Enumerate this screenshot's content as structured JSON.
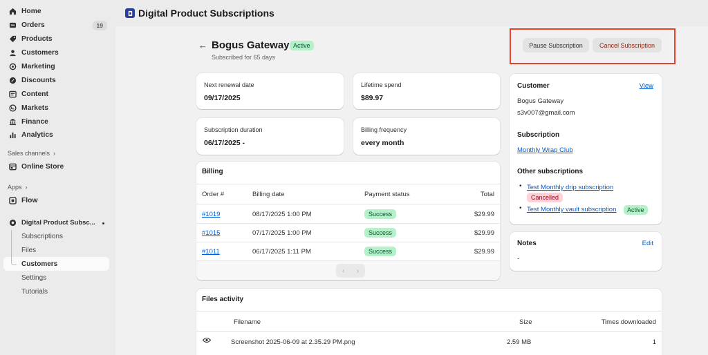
{
  "sidebar": {
    "items": [
      {
        "label": "Home",
        "icon": "home-icon"
      },
      {
        "label": "Orders",
        "icon": "orders-icon",
        "badge": "19"
      },
      {
        "label": "Products",
        "icon": "tag-icon"
      },
      {
        "label": "Customers",
        "icon": "person-icon"
      },
      {
        "label": "Marketing",
        "icon": "target-icon"
      },
      {
        "label": "Discounts",
        "icon": "discount-icon"
      },
      {
        "label": "Content",
        "icon": "content-icon"
      },
      {
        "label": "Markets",
        "icon": "globe-icon"
      },
      {
        "label": "Finance",
        "icon": "bank-icon"
      },
      {
        "label": "Analytics",
        "icon": "bar-chart-icon"
      }
    ],
    "sales_channels_label": "Sales channels",
    "online_store_label": "Online Store",
    "apps_label": "Apps",
    "flow_label": "Flow",
    "app_label": "Digital Product Subsc...",
    "app_subitems": [
      "Subscriptions",
      "Files",
      "Customers",
      "Settings",
      "Tutorials"
    ]
  },
  "header": {
    "title": "Digital Product Subscriptions"
  },
  "page": {
    "back_icon": "arrow-left-icon",
    "title": "Bogus Gateway",
    "status": "Active",
    "subtitle": "Subscribed for 65 days",
    "pause_label": "Pause Subscription",
    "cancel_label": "Cancel Subscription"
  },
  "stats": {
    "next_renewal_label": "Next renewal date",
    "next_renewal_value": "09/17/2025",
    "lifetime_label": "Lifetime spend",
    "lifetime_value": "$89.97",
    "duration_label": "Subscription duration",
    "duration_value": "06/17/2025 -",
    "frequency_label": "Billing frequency",
    "frequency_value": "every month"
  },
  "billing": {
    "title": "Billing",
    "headers": [
      "Order #",
      "Billing date",
      "Payment status",
      "Total"
    ],
    "rows": [
      {
        "order": "#1019",
        "date": "08/17/2025 1:00 PM",
        "status": "Success",
        "total": "$29.99"
      },
      {
        "order": "#1015",
        "date": "07/17/2025 1:00 PM",
        "status": "Success",
        "total": "$29.99"
      },
      {
        "order": "#1011",
        "date": "06/17/2025 1:11 PM",
        "status": "Success",
        "total": "$29.99"
      }
    ]
  },
  "files": {
    "title": "Files activity",
    "headers": [
      "Filename",
      "Size",
      "Times downloaded"
    ],
    "rows": [
      {
        "filename": "Screenshot 2025-06-09 at 2.35.29 PM.png",
        "size": "2.59 MB",
        "downloads": "1"
      }
    ]
  },
  "customer": {
    "title": "Customer",
    "view_label": "View",
    "name": "Bogus Gateway",
    "email": "s3v007@gmail.com",
    "subscription_title": "Subscription",
    "subscription_link": "Monthly Wrap Club",
    "other_title": "Other subscriptions",
    "others": [
      {
        "label": "Test Monthly drip subscription",
        "status": "Cancelled"
      },
      {
        "label": "Test Monthly vault subscription",
        "status": "Active"
      }
    ]
  },
  "notes": {
    "title": "Notes",
    "edit_label": "Edit",
    "value": "-"
  },
  "colors": {
    "accent_link": "#005bd3",
    "success_bg": "#b4f0c8",
    "cancelled_bg": "#fed1d7",
    "highlight_border": "#e8402b"
  }
}
